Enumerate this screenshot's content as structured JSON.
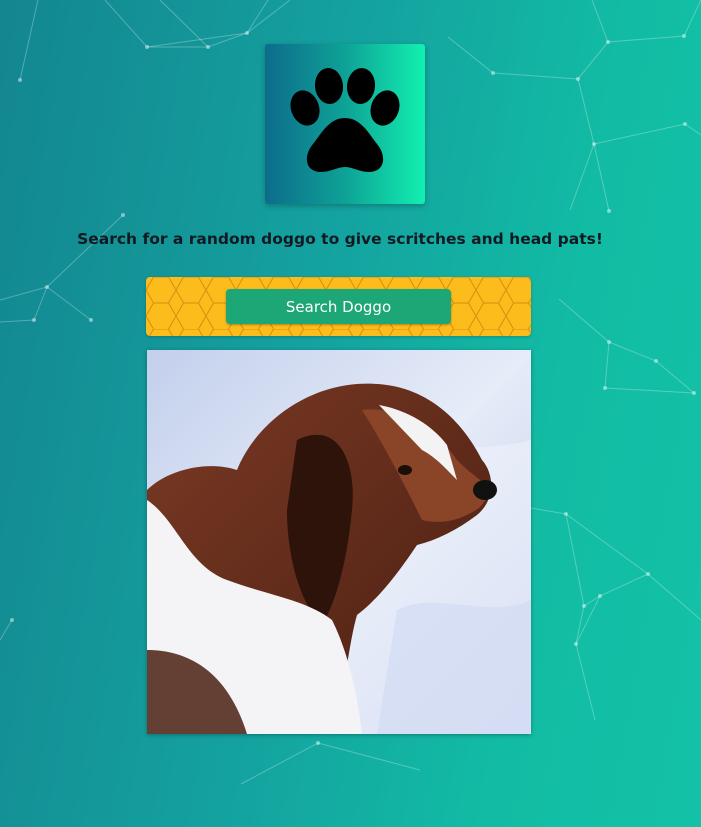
{
  "page": {
    "tagline": "Search for a random doggo to give scritches and head pats!"
  },
  "logo": {
    "icon": "paw-print-icon"
  },
  "search": {
    "button_label": "Search Doggo",
    "pattern": "honeycomb"
  },
  "photo": {
    "subject": "dog-image"
  },
  "colors": {
    "background_start": "#13868f",
    "background_end": "#13c2a6",
    "logo_gradient_start": "#0d6c8c",
    "logo_gradient_end": "#12f0b0",
    "search_bar": "#fcbc1b",
    "button": "#1ea776",
    "text": "#111a22"
  }
}
